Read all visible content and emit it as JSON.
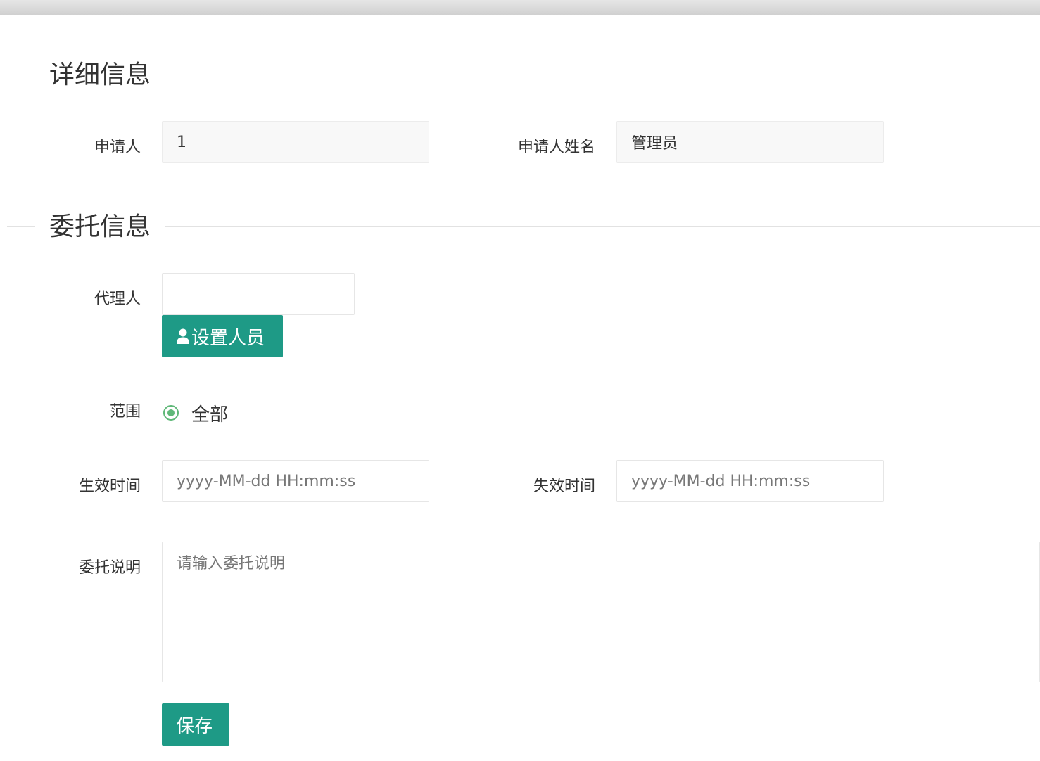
{
  "sections": {
    "detail_title": "详细信息",
    "delegate_title": "委托信息"
  },
  "detail": {
    "applicant_label": "申请人",
    "applicant_value": "1",
    "applicant_name_label": "申请人姓名",
    "applicant_name_value": "管理员"
  },
  "delegate": {
    "agent_label": "代理人",
    "agent_value": "",
    "set_person_button": "设置人员",
    "scope_label": "范围",
    "scope_option": "全部",
    "effective_time_label": "生效时间",
    "effective_time_placeholder": "yyyy-MM-dd HH:mm:ss",
    "expire_time_label": "失效时间",
    "expire_time_placeholder": "yyyy-MM-dd HH:mm:ss",
    "description_label": "委托说明",
    "description_placeholder": "请输入委托说明",
    "save_button": "保存"
  },
  "colors": {
    "primary": "#1e9a86",
    "radio": "#5fb878"
  },
  "icons": {
    "set_person_icon": "person-icon",
    "radio_icon": "radio-checked-icon"
  }
}
